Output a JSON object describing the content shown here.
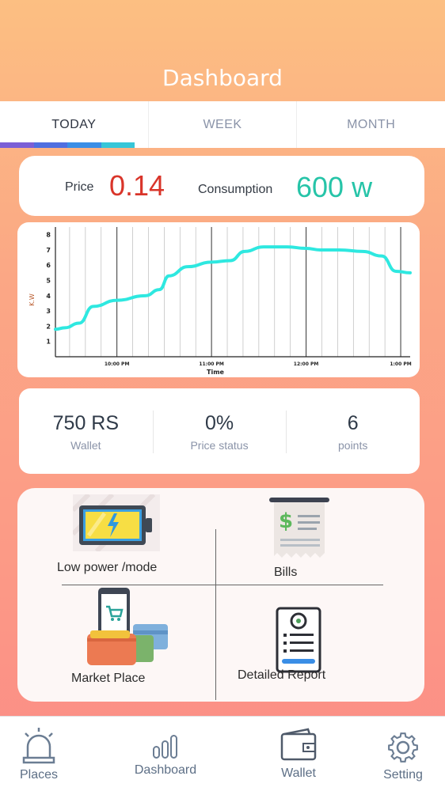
{
  "header": {
    "title": "Dashboard"
  },
  "tabs": [
    {
      "label": "TODAY",
      "active": true
    },
    {
      "label": "WEEK",
      "active": false
    },
    {
      "label": "MONTH",
      "active": false
    }
  ],
  "tab_indicator_colors": [
    "#7b5fd6",
    "#4f6fe0",
    "#3a8ee6",
    "#36c6d8"
  ],
  "price": {
    "label": "Price",
    "value": "0.14",
    "color": "#d9352a"
  },
  "consumption": {
    "label": "Consumption",
    "value": "600 w",
    "color": "#26c4a8"
  },
  "chart_data": {
    "type": "line",
    "title": "",
    "xlabel": "Time",
    "ylabel": "K.W",
    "x_tick_labels": [
      "10:00 PM",
      "11:00 PM",
      "12:00 PM",
      "1:00 PM"
    ],
    "y_tick_labels": [
      "1",
      "2",
      "3",
      "4",
      "5",
      "6",
      "7",
      "8"
    ],
    "ylim": [
      0,
      8.5
    ],
    "line_color": "#2ee8e0",
    "x_hours": [
      21.35,
      21.45,
      21.6,
      21.75,
      22.0,
      22.3,
      22.45,
      22.55,
      22.75,
      23.0,
      23.2,
      23.35,
      23.55,
      23.8,
      24.0,
      24.15,
      24.35,
      24.6,
      24.8,
      24.95,
      25.1
    ],
    "series": [
      {
        "values": [
          1.8,
          1.9,
          2.2,
          3.3,
          3.7,
          4.0,
          4.4,
          5.3,
          5.9,
          6.2,
          6.3,
          6.9,
          7.2,
          7.2,
          7.1,
          7.0,
          7.0,
          6.9,
          6.6,
          5.6,
          5.5
        ]
      }
    ],
    "grid": true
  },
  "stats": [
    {
      "value": "750 RS",
      "label": "Wallet"
    },
    {
      "value": "0%",
      "label": "Price status"
    },
    {
      "value": "6",
      "label": "points"
    }
  ],
  "menu": {
    "low_power": {
      "label": "Low power /mode",
      "icon": "battery-icon"
    },
    "bills": {
      "label": "Bills",
      "icon": "bill-icon"
    },
    "market": {
      "label": "Market Place",
      "icon": "market-place-icon"
    },
    "report": {
      "label": "Detailed Report",
      "icon": "report-icon"
    }
  },
  "bottom_nav": [
    {
      "label": "Places",
      "icon": "alarm-icon"
    },
    {
      "label": "Dashboard",
      "icon": "bar-chart-icon"
    },
    {
      "label": "Wallet",
      "icon": "wallet-icon"
    },
    {
      "label": "Setting",
      "icon": "gear-icon"
    }
  ]
}
